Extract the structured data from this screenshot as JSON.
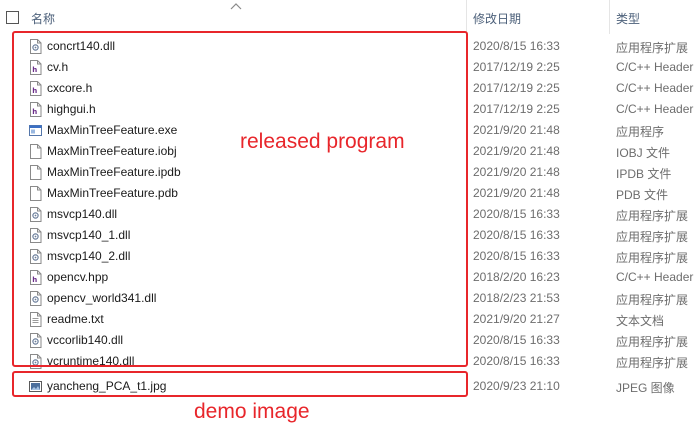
{
  "columns": {
    "name": "名称",
    "date": "修改日期",
    "type": "类型"
  },
  "files": [
    {
      "name": "concrt140.dll",
      "date": "2020/8/15 16:33",
      "type": "应用程序扩展",
      "icon": "dll-icon"
    },
    {
      "name": "cv.h",
      "date": "2017/12/19 2:25",
      "type": "C/C++ Header",
      "icon": "header-file-icon"
    },
    {
      "name": "cxcore.h",
      "date": "2017/12/19 2:25",
      "type": "C/C++ Header",
      "icon": "header-file-icon"
    },
    {
      "name": "highgui.h",
      "date": "2017/12/19 2:25",
      "type": "C/C++ Header",
      "icon": "header-file-icon"
    },
    {
      "name": "MaxMinTreeFeature.exe",
      "date": "2021/9/20 21:48",
      "type": "应用程序",
      "icon": "exe-icon"
    },
    {
      "name": "MaxMinTreeFeature.iobj",
      "date": "2021/9/20 21:48",
      "type": "IOBJ 文件",
      "icon": "blank-file-icon"
    },
    {
      "name": "MaxMinTreeFeature.ipdb",
      "date": "2021/9/20 21:48",
      "type": "IPDB 文件",
      "icon": "blank-file-icon"
    },
    {
      "name": "MaxMinTreeFeature.pdb",
      "date": "2021/9/20 21:48",
      "type": "PDB 文件",
      "icon": "blank-file-icon"
    },
    {
      "name": "msvcp140.dll",
      "date": "2020/8/15 16:33",
      "type": "应用程序扩展",
      "icon": "dll-icon"
    },
    {
      "name": "msvcp140_1.dll",
      "date": "2020/8/15 16:33",
      "type": "应用程序扩展",
      "icon": "dll-icon"
    },
    {
      "name": "msvcp140_2.dll",
      "date": "2020/8/15 16:33",
      "type": "应用程序扩展",
      "icon": "dll-icon"
    },
    {
      "name": "opencv.hpp",
      "date": "2018/2/20 16:23",
      "type": "C/C++ Header",
      "icon": "header-file-icon"
    },
    {
      "name": "opencv_world341.dll",
      "date": "2018/2/23 21:53",
      "type": "应用程序扩展",
      "icon": "dll-icon"
    },
    {
      "name": "readme.txt",
      "date": "2021/9/20 21:27",
      "type": "文本文档",
      "icon": "text-file-icon"
    },
    {
      "name": "vccorlib140.dll",
      "date": "2020/8/15 16:33",
      "type": "应用程序扩展",
      "icon": "dll-icon"
    },
    {
      "name": "vcruntime140.dll",
      "date": "2020/8/15 16:33",
      "type": "应用程序扩展",
      "icon": "dll-icon"
    },
    {
      "name": "yancheng_PCA_t1.jpg",
      "date": "2020/9/23 21:10",
      "type": "JPEG 图像",
      "icon": "image-file-icon"
    }
  ],
  "annotations": {
    "program_label": "released  program",
    "image_label": "demo image",
    "color": "#e8262b"
  }
}
